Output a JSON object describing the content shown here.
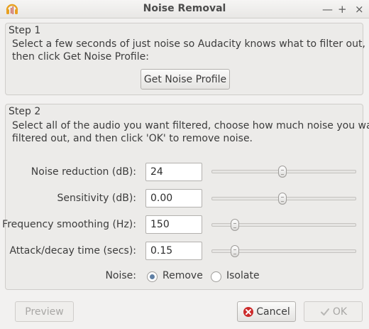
{
  "window": {
    "title": "Noise Removal",
    "controls": {
      "minimize": "—",
      "maximize": "+",
      "close": "×"
    }
  },
  "step1": {
    "title": "Step 1",
    "line1": "Select a few seconds of just noise so Audacity knows what to filter out,",
    "line2": "then click Get Noise Profile:",
    "button": "Get Noise Profile"
  },
  "step2": {
    "title": "Step 2",
    "line1": "Select all of the audio you want filtered, choose how much noise you want",
    "line2": "filtered out, and then click 'OK' to remove noise.",
    "params": [
      {
        "label": "Noise reduction (dB):",
        "value": "24",
        "slider_fraction": 0.49
      },
      {
        "label": "Sensitivity (dB):",
        "value": "0.00",
        "slider_fraction": 0.49
      },
      {
        "label": "Frequency smoothing (Hz):",
        "value": "150",
        "slider_fraction": 0.16
      },
      {
        "label": "Attack/decay time (secs):",
        "value": "0.15",
        "slider_fraction": 0.16
      }
    ],
    "noise": {
      "label": "Noise:",
      "options": [
        {
          "label": "Remove",
          "selected": true
        },
        {
          "label": "Isolate",
          "selected": false
        }
      ]
    }
  },
  "buttons": {
    "preview": "Preview",
    "cancel": "Cancel",
    "ok": "OK"
  },
  "colors": {
    "accent_radio": "#5f7fa4",
    "cancel_icon": "#cc2b2b",
    "audacity_icon": "#e8a020"
  }
}
